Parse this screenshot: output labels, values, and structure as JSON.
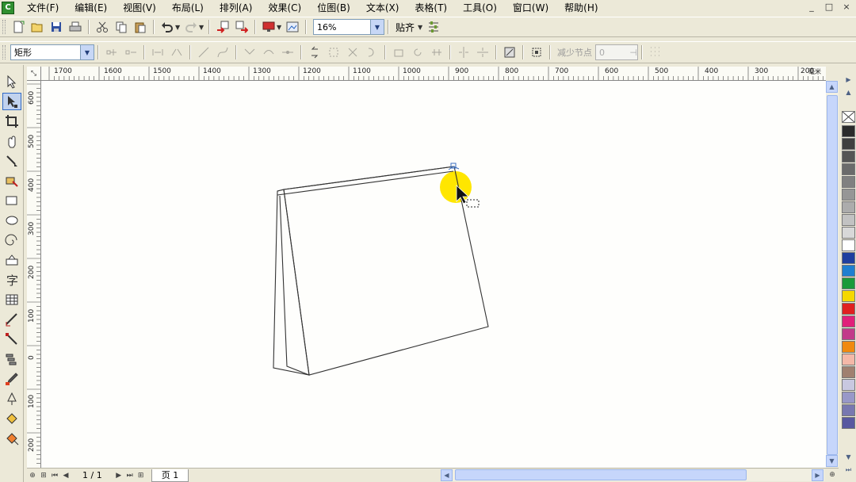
{
  "app": {
    "icon_text": "C"
  },
  "menu": [
    "文件(F)",
    "编辑(E)",
    "视图(V)",
    "布局(L)",
    "排列(A)",
    "效果(C)",
    "位图(B)",
    "文本(X)",
    "表格(T)",
    "工具(O)",
    "窗口(W)",
    "帮助(H)"
  ],
  "window_controls": [
    "_",
    "□",
    "×"
  ],
  "std_toolbar": {
    "icons": [
      "new-icon",
      "open-icon",
      "save-icon",
      "print-icon",
      "cut-icon",
      "copy-icon",
      "paste-icon",
      "undo-icon",
      "redo-icon",
      "import-icon",
      "export-icon",
      "publish-icon",
      "welcome-icon"
    ],
    "zoom_value": "16%",
    "snap_label": "贴齐"
  },
  "prop_toolbar": {
    "shape_value": "矩形",
    "reduce_nodes_label": "减少节点",
    "reduce_nodes_value": "0"
  },
  "rulers": {
    "unit": "毫米",
    "horizontal_labels": [
      "1700",
      "1600",
      "1500",
      "1400",
      "1300",
      "1200",
      "1100",
      "1000",
      "900",
      "800",
      "700",
      "600",
      "500",
      "400",
      "300",
      "200"
    ],
    "vertical_labels": [
      "600",
      "500",
      "400",
      "300",
      "200",
      "100",
      "0",
      "100",
      "200"
    ]
  },
  "status": {
    "page_count": "1 / 1",
    "page_tab": "页 1"
  },
  "palette": {
    "colors": [
      "#2b2b2b",
      "#3f3f3f",
      "#555555",
      "#6b6b6b",
      "#808080",
      "#969696",
      "#acacac",
      "#c2c2c2",
      "#d8d8d8",
      "#ffffff",
      "#1f3f9f",
      "#1e7fd0",
      "#1a9a3a",
      "#f5d800",
      "#e02020",
      "#e0207a",
      "#c23b8a",
      "#f08a10",
      "#f4b8a8",
      "#a08070",
      "#c8c8e0",
      "#9898c8",
      "#7878b0",
      "#5858a0"
    ]
  },
  "colors": {
    "highlight": "#ffe600",
    "outline": "#333333"
  }
}
